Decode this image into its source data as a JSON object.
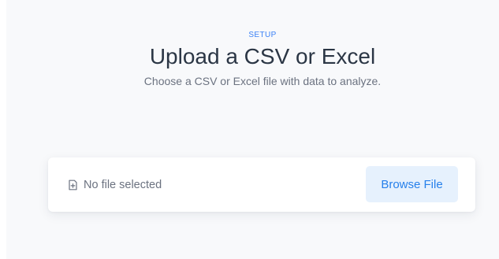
{
  "header": {
    "eyebrow": "SETUP",
    "title": "Upload a CSV or Excel",
    "subtitle": "Choose a CSV or Excel file with data to analyze."
  },
  "upload": {
    "file_icon": "file-plus-icon",
    "status_text": "No file selected",
    "browse_label": "Browse File"
  },
  "colors": {
    "accent": "#2680eb",
    "button_bg": "#e6f1fd",
    "title": "#2b3645",
    "muted": "#6b7280",
    "panel_bg": "#f8f9fb"
  }
}
